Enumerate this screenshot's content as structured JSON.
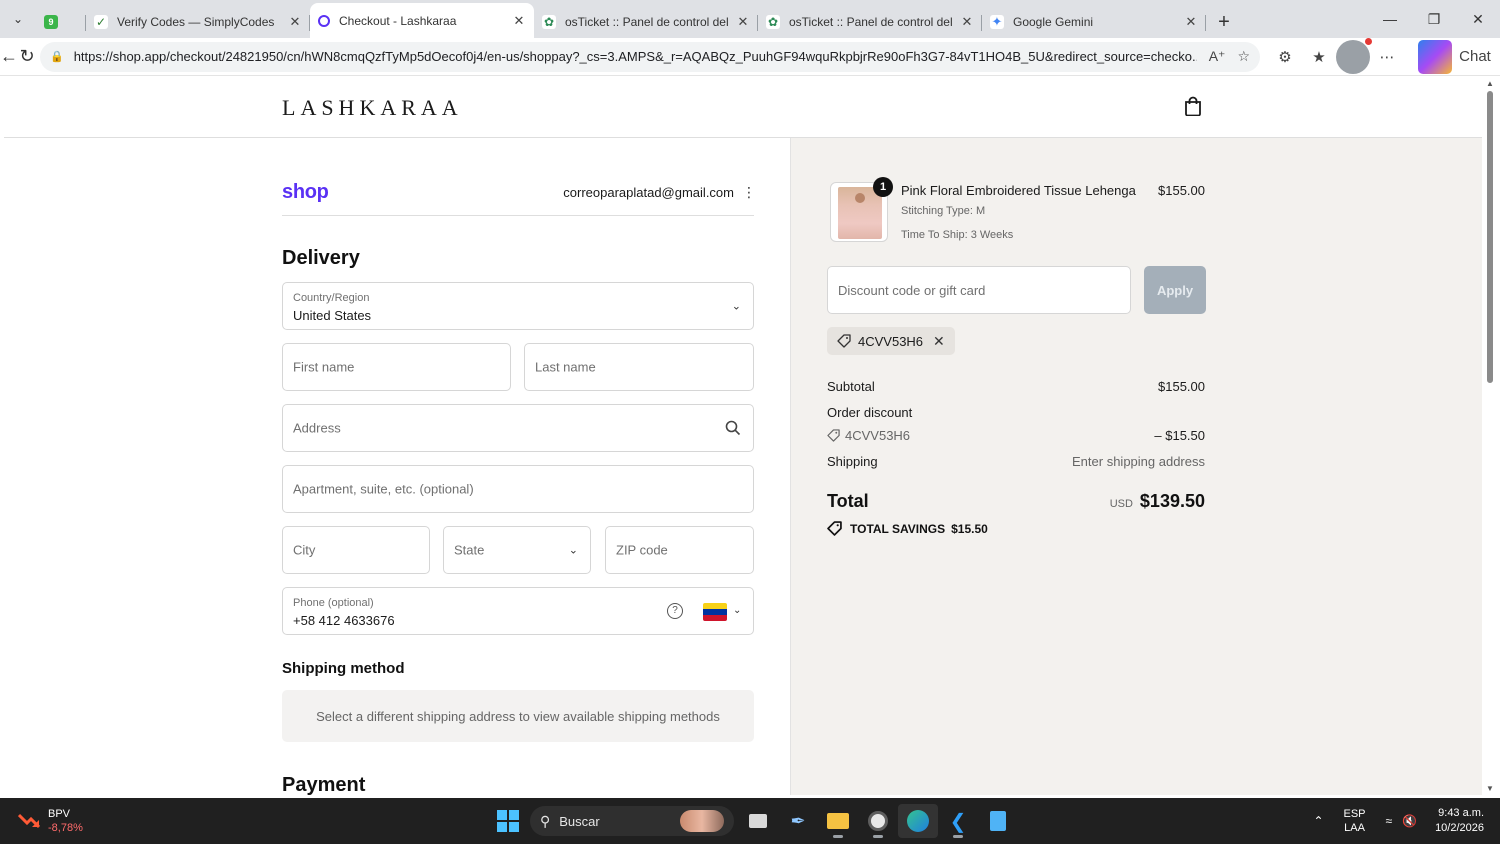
{
  "browser": {
    "tabs": [
      {
        "title": "",
        "icon": "simplycodes-badge-icon",
        "active": false
      },
      {
        "title": "Verify Codes — SimplyCodes",
        "icon": "simplycodes-check-icon",
        "active": false
      },
      {
        "title": "Checkout - Lashkaraa",
        "icon": "shop-pay-icon",
        "active": true
      },
      {
        "title": "osTicket :: Panel de control del adm",
        "icon": "osticket-icon",
        "active": false
      },
      {
        "title": "osTicket :: Panel de control del adm",
        "icon": "osticket-icon",
        "active": false
      },
      {
        "title": "Google Gemini",
        "icon": "gemini-icon",
        "active": false
      }
    ],
    "url": "https://shop.app/checkout/24821950/cn/hWN8cmqQzfTyMp5dOecof0j4/en-us/shoppay?_cs=3.AMPS&_r=AQABQz_PuuhGF94wquRkpbjrRe90oFh3G7-84vT1HO4B_5U&redirect_source=checko...",
    "chat_label": "Chat"
  },
  "store": {
    "logo": "LASHKARAA"
  },
  "checkout": {
    "shop_logo": "shop",
    "email": "correoparaplatad@gmail.com",
    "delivery_heading": "Delivery",
    "country_label": "Country/Region",
    "country_value": "United States",
    "first_name_placeholder": "First name",
    "last_name_placeholder": "Last name",
    "address_placeholder": "Address",
    "apartment_placeholder": "Apartment, suite, etc. (optional)",
    "city_placeholder": "City",
    "state_placeholder": "State",
    "zip_placeholder": "ZIP code",
    "phone_label": "Phone (optional)",
    "phone_value": "+58 412 4633676",
    "help_glyph": "?",
    "shipping_heading": "Shipping method",
    "shipping_message": "Select a different shipping address to view available shipping methods",
    "payment_heading": "Payment"
  },
  "summary": {
    "product": {
      "quantity": "1",
      "name": "Pink Floral Embroidered Tissue Lehenga",
      "stitching": "Stitching Type: M",
      "ship_time": "Time To Ship: 3 Weeks",
      "price": "$155.00"
    },
    "discount_placeholder": "Discount code or gift card",
    "apply_label": "Apply",
    "applied_code": "4CVV53H6",
    "subtotal_label": "Subtotal",
    "subtotal_value": "$155.00",
    "order_discount_label": "Order discount",
    "discount_code": "4CVV53H6",
    "discount_value": "– $15.50",
    "shipping_label": "Shipping",
    "shipping_value": "Enter shipping address",
    "total_label": "Total",
    "currency": "USD",
    "total_value": "$139.50",
    "savings_label": "TOTAL SAVINGS",
    "savings_value": "$15.50"
  },
  "taskbar": {
    "stock_name": "BPV",
    "stock_change": "-8,78%",
    "search_label": "Buscar",
    "lang_top": "ESP",
    "lang_bottom": "LAA",
    "time": "9:43 a.m.",
    "date": "10/2/2026"
  },
  "colors": {
    "shop_purple": "#5a31f4",
    "summary_bg": "#f3f1ee",
    "apply_disabled": "#a4afb9"
  }
}
